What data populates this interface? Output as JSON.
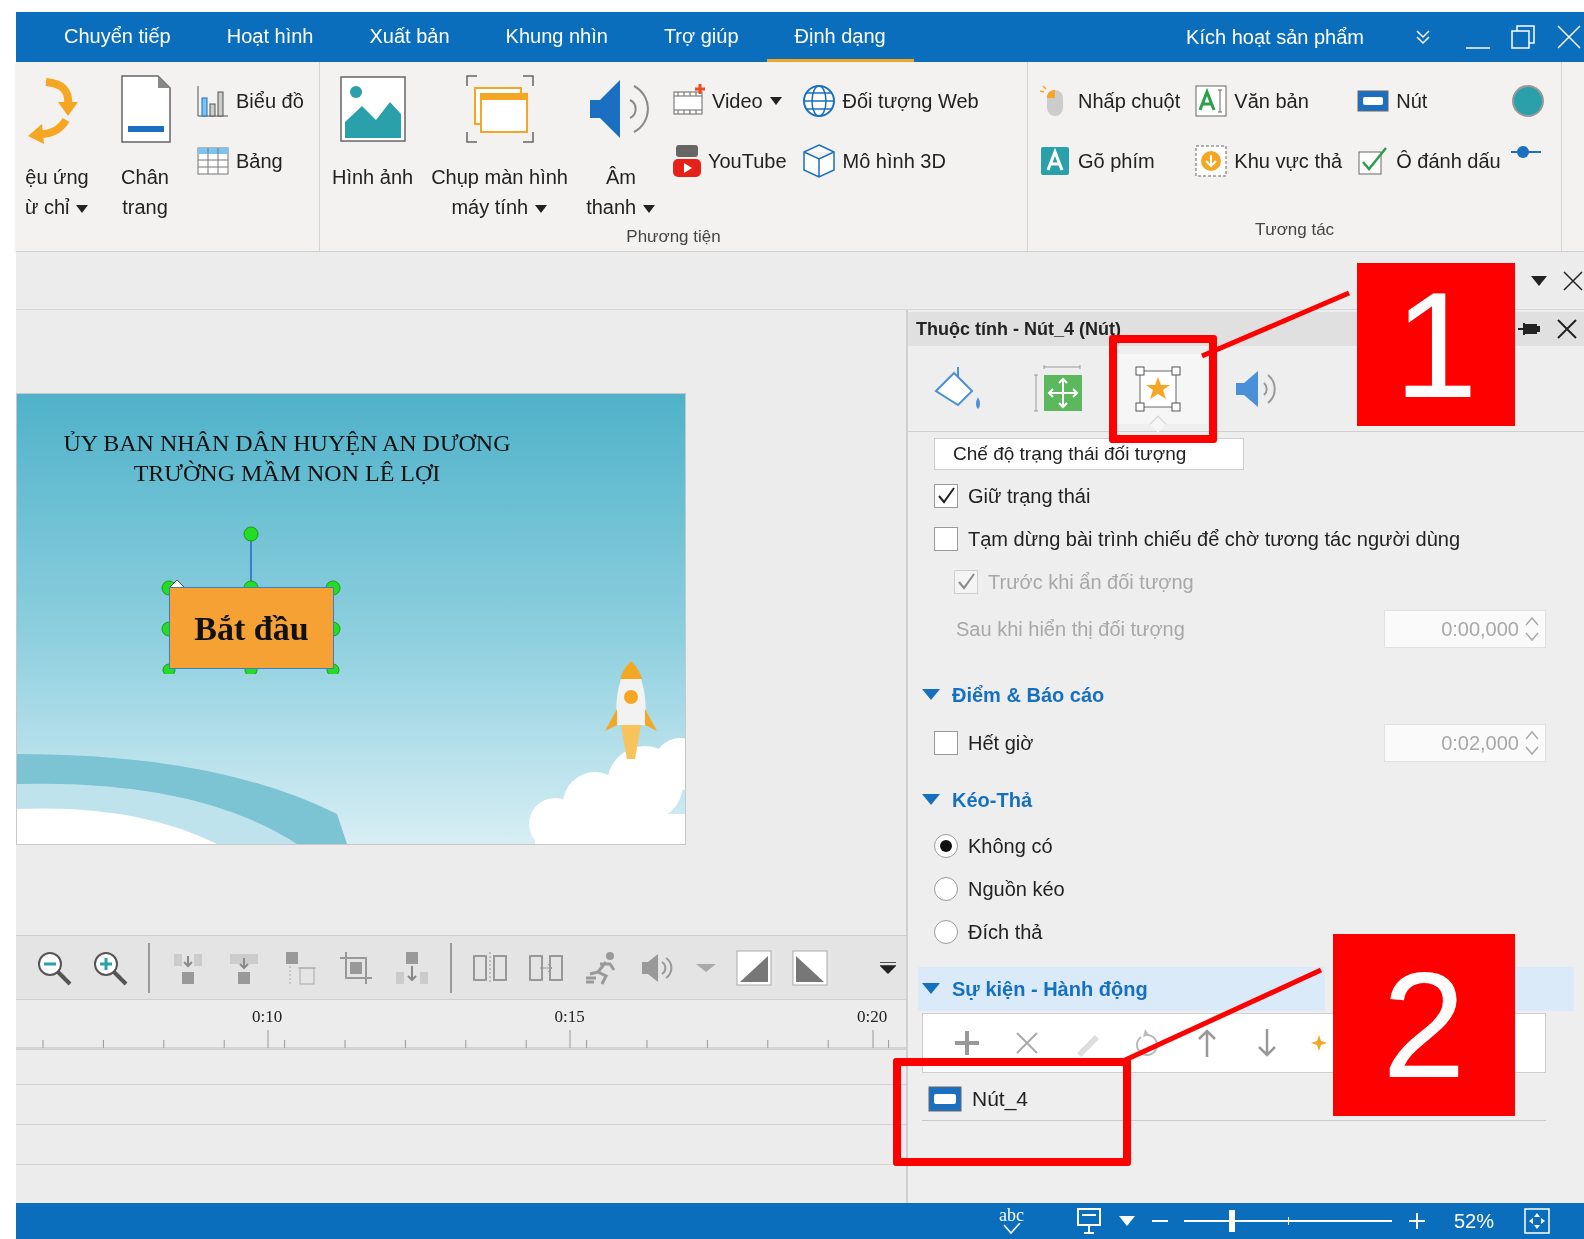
{
  "menu_tabs": [
    {
      "label": "Chuyển tiếp",
      "selected": false
    },
    {
      "label": "Hoạt hình",
      "selected": false
    },
    {
      "label": "Xuất bản",
      "selected": false
    },
    {
      "label": "Khung nhìn",
      "selected": false
    },
    {
      "label": "Trợ giúp",
      "selected": false
    },
    {
      "label": "Định dạng",
      "selected": true
    }
  ],
  "activation_link": "Kích hoạt sản phẩm",
  "ribbon": {
    "groups": [
      {
        "columns": [
          {
            "kind": "large",
            "lines": [
              "ệu ứng",
              "ừ chỉ"
            ],
            "dropdown": true
          },
          {
            "kind": "large",
            "lines": [
              "Chân",
              "trang"
            ],
            "dropdown": false
          },
          {
            "kind": "stack",
            "items": [
              {
                "label": "Biểu đồ",
                "dropdown": false
              },
              {
                "label": "Bảng",
                "dropdown": false
              }
            ]
          }
        ]
      },
      {
        "label": "Phương tiện",
        "columns": [
          {
            "kind": "large",
            "lines": [
              "Hình ảnh"
            ],
            "dropdown": false
          },
          {
            "kind": "large",
            "lines": [
              "Chụp màn hình",
              "máy tính"
            ],
            "dropdown": true
          },
          {
            "kind": "large",
            "lines": [
              "Âm",
              "thanh"
            ],
            "dropdown": true
          },
          {
            "kind": "stack",
            "items": [
              {
                "label": "Video",
                "dropdown": true
              },
              {
                "label": "YouTube",
                "dropdown": false
              }
            ]
          },
          {
            "kind": "stack",
            "items": [
              {
                "label": "Đối tượng Web",
                "dropdown": false
              },
              {
                "label": "Mô hình 3D",
                "dropdown": false
              }
            ]
          }
        ]
      },
      {
        "label": "Tương tác",
        "columns": [
          {
            "kind": "stack",
            "items": [
              {
                "label": "Nhấp chuột",
                "dropdown": false
              },
              {
                "label": "Gõ phím",
                "dropdown": false
              }
            ]
          },
          {
            "kind": "stack",
            "items": [
              {
                "label": "Văn bản",
                "dropdown": false
              },
              {
                "label": "Khu vực thả",
                "dropdown": false
              }
            ]
          },
          {
            "kind": "stack",
            "items": [
              {
                "label": "Nút",
                "dropdown": false
              },
              {
                "label": "Ô đánh dấu",
                "dropdown": false
              }
            ]
          }
        ]
      }
    ]
  },
  "slide": {
    "lines": [
      "ỦY BAN NHÂN DÂN HUYỆN AN DƯƠNG",
      "TRƯỜNG MẦM NON LÊ LỢI"
    ],
    "button": "Bắt đầu"
  },
  "timeline": {
    "ruler_labels": [
      "0:10",
      "0:15",
      "0:20"
    ]
  },
  "properties": {
    "title": "Thuộc tính - Nút_4 (Nút)",
    "tabs": [
      {
        "selected": false
      },
      {
        "selected": false
      },
      {
        "selected": true
      },
      {
        "selected": false
      }
    ],
    "state_field": "Chế độ trạng thái đối tượng",
    "options": [
      {
        "kind": "checkbox",
        "label": "Giữ trạng thái",
        "checked": true,
        "disabled": false
      },
      {
        "kind": "checkbox",
        "label": "Tạm dừng bài trình chiếu để chờ tương tác người dùng",
        "checked": false,
        "disabled": false
      },
      {
        "kind": "checkbox",
        "label": "Trước khi ẩn đối tượng",
        "checked": true,
        "disabled": true
      },
      {
        "kind": "timing",
        "label": "Sau khi hiển thị đối tượng",
        "value": "0:00,000",
        "disabled": true
      }
    ],
    "sections": [
      {
        "title": "Điểm & Báo cáo",
        "selected": false,
        "options": [
          {
            "kind": "checkbox_timing",
            "label": "Hết giờ",
            "checked": false,
            "value": "0:02,000"
          }
        ]
      },
      {
        "title": "Kéo-Thả",
        "selected": false,
        "options": [
          {
            "kind": "radio",
            "label": "Không có",
            "selected": true
          },
          {
            "kind": "radio",
            "label": "Nguồn kéo",
            "selected": false
          },
          {
            "kind": "radio",
            "label": "Đích thả",
            "selected": false
          }
        ]
      },
      {
        "title": "Sự kiện - Hành động",
        "selected": true,
        "events": [
          {
            "label": "Nút_4"
          }
        ]
      }
    ]
  },
  "status": {
    "spell_label": "abc",
    "zoom": {
      "level": 0.23
    },
    "zoom_label": "52%"
  },
  "annotations": [
    {
      "label": "1"
    },
    {
      "label": "2"
    }
  ]
}
